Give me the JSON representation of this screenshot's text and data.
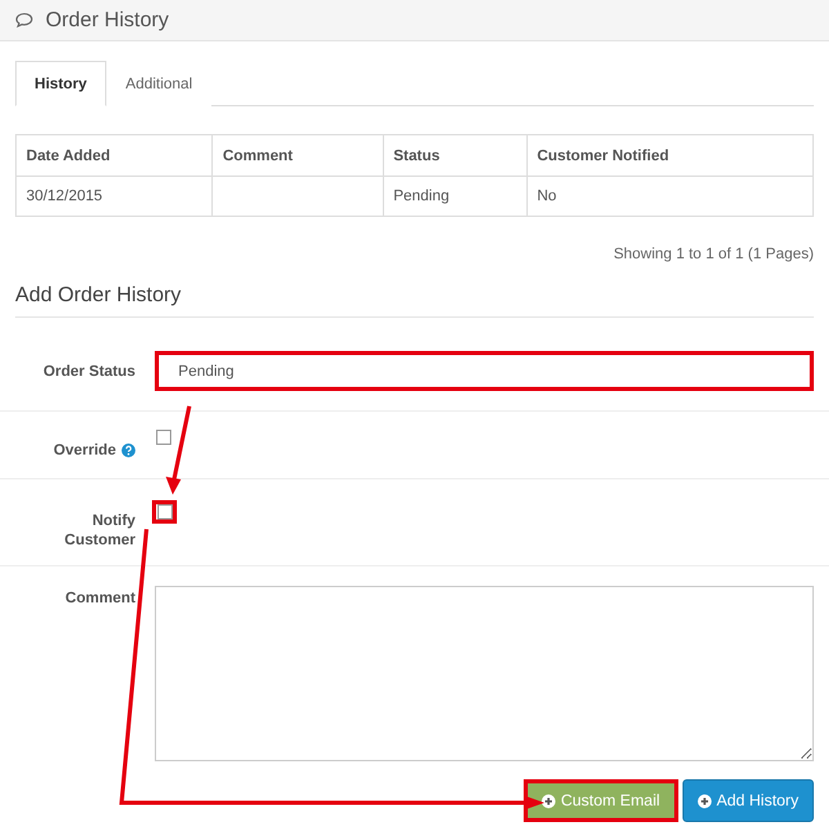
{
  "panel": {
    "title": "Order History"
  },
  "tabs": [
    {
      "label": "History",
      "selected": true
    },
    {
      "label": "Additional",
      "selected": false
    }
  ],
  "table": {
    "columns": [
      "Date Added",
      "Comment",
      "Status",
      "Customer Notified"
    ],
    "rows": [
      {
        "date_added": "30/12/2015",
        "status": "Pending",
        "customer_notified": "No"
      }
    ]
  },
  "pagination": "Showing 1 to 1 of 1 (1 Pages)",
  "form": {
    "title": "Add Order History",
    "fields": [
      {
        "kind": "select",
        "label": "Order Status",
        "value": "Pending",
        "highlighted": true
      },
      {
        "kind": "checkbox",
        "label": "Override",
        "help": true,
        "checked": false
      },
      {
        "kind": "checkbox",
        "label": "Notify Customer",
        "checked": false,
        "highlighted": true
      },
      {
        "kind": "textarea",
        "label": "Comment"
      }
    ]
  },
  "buttons": [
    {
      "label": "Custom Email",
      "kind": "success",
      "highlighted": true
    },
    {
      "label": "Add History",
      "kind": "primary"
    }
  ]
}
